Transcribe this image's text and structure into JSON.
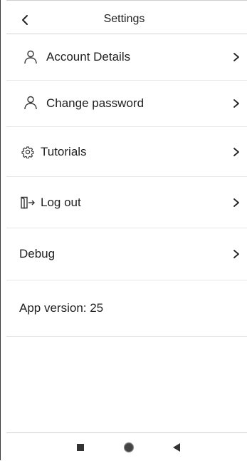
{
  "header": {
    "title": "Settings",
    "back_icon": "chevron-left-icon"
  },
  "menu": {
    "items": [
      {
        "label": "Account Details",
        "icon": "person-icon",
        "has_chevron": true
      },
      {
        "label": "Change password",
        "icon": "person-icon",
        "has_chevron": true
      },
      {
        "label": "Tutorials",
        "icon": "gear-icon",
        "has_chevron": true
      },
      {
        "label": "Log out",
        "icon": "logout-icon",
        "has_chevron": true
      },
      {
        "label": "Debug",
        "icon": "",
        "has_chevron": true
      }
    ],
    "chevron_icon": "chevron-right-icon"
  },
  "app_version": {
    "label": "App version: 25"
  },
  "system_nav": {
    "icons": [
      "recents-square-icon",
      "home-circle-icon",
      "back-triangle-icon"
    ]
  },
  "colors": {
    "text": "#222222",
    "divider": "#e6e6e6",
    "icon": "#333333"
  }
}
